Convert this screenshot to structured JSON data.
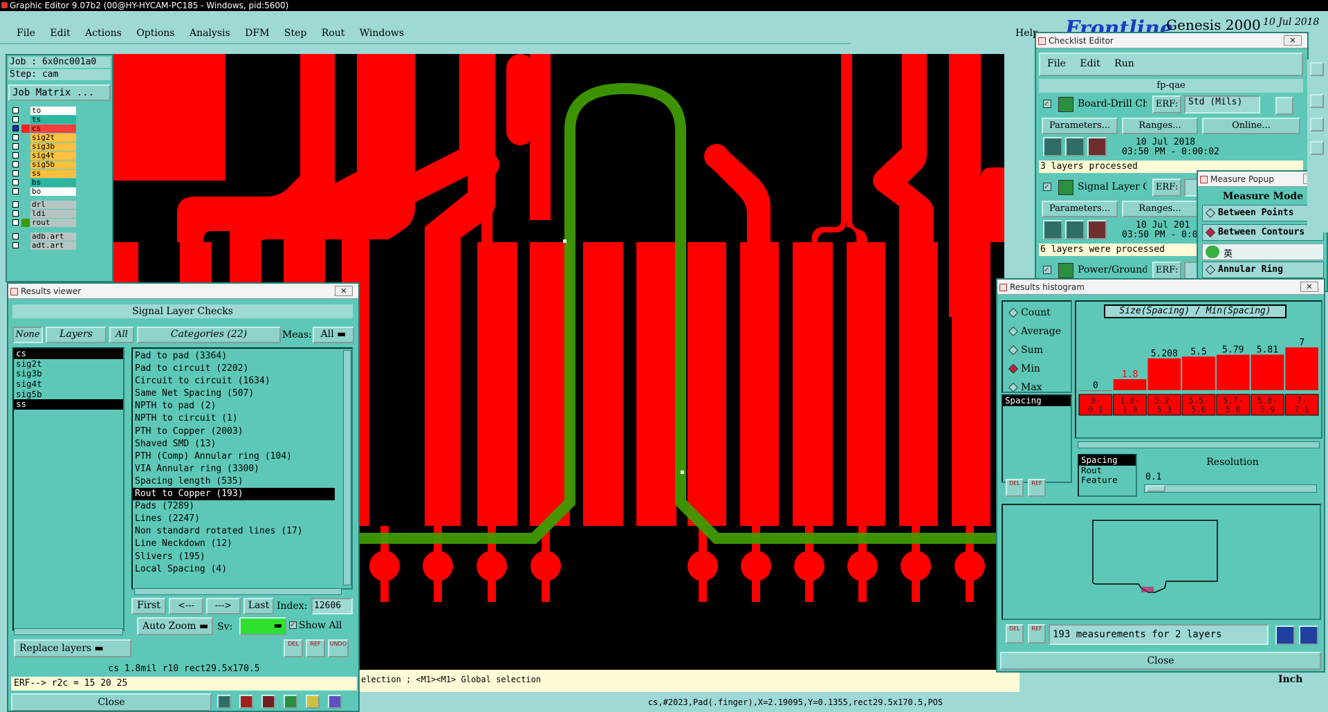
{
  "app": {
    "title": "Graphic Editor 9.07b2 (00@HY-HYCAM-PC185 - Windows, pid:5600)"
  },
  "menu": {
    "items": [
      "File",
      "Edit",
      "Actions",
      "Options",
      "Analysis",
      "DFM",
      "Step",
      "Rout",
      "Windows"
    ],
    "help": "Help"
  },
  "branding": {
    "brand": "Frontline",
    "product": "Genesis 2000",
    "date": "10 Jul 2018",
    "time_fragment": "03:50 PM",
    "subtitle": "Graphic Editor"
  },
  "job": {
    "job_label": "Job : 6x0nc001a0",
    "step_label": "Step: cam",
    "matrix_button": "Job Matrix ..."
  },
  "layers": [
    {
      "name": "to",
      "color": "#ffffff"
    },
    {
      "name": "ts",
      "color": "#2fb59e"
    },
    {
      "name": "cs",
      "color": "#ff3c3c"
    },
    {
      "name": "sig2t",
      "color": "#ffbf40"
    },
    {
      "name": "sig3b",
      "color": "#ffbf40"
    },
    {
      "name": "sig4t",
      "color": "#ffbf40"
    },
    {
      "name": "sig5b",
      "color": "#ffbf40"
    },
    {
      "name": "ss",
      "color": "#ffbf40"
    },
    {
      "name": "bs",
      "color": "#2fb59e"
    },
    {
      "name": "bo",
      "color": "#ffffff"
    },
    {
      "name": "drl",
      "color": "#b7c4c4"
    },
    {
      "name": "ldi",
      "color": "#b7c4c4"
    },
    {
      "name": "rout",
      "color": "#b7c4c4"
    },
    {
      "name": "adb.art",
      "color": "#b7c4c4"
    },
    {
      "name": "adt.art",
      "color": "#b7c4c4"
    }
  ],
  "results_viewer": {
    "title": "Results viewer",
    "header": "Signal Layer Checks",
    "none_btn": "None",
    "layers_btn": "Layers",
    "all_btn": "All",
    "categories_btn": "Categories (22)",
    "meas_label": "Meas:",
    "meas_value": "All",
    "layer_list": [
      "cs",
      "sig2t",
      "sig3b",
      "sig4t",
      "sig5b",
      "ss"
    ],
    "categories": [
      "Pad to pad (3364)",
      "Pad to circuit (2202)",
      "Circuit to circuit (1634)",
      "Same Net Spacing (507)",
      "NPTH to pad (2)",
      "NPTH to circuit (1)",
      "PTH to Copper (2003)",
      "Shaved SMD (13)",
      "PTH (Comp) Annular ring (104)",
      "VIA Annular ring (3300)",
      "Spacing length (535)",
      "Rout to Copper (193)",
      "Pads (7289)",
      "Lines (2247)",
      "Non standard rotated lines (17)",
      "Line Neckdown (12)",
      "Slivers (195)",
      "Local Spacing (4)"
    ],
    "first": "First",
    "prev": "<---",
    "next": "--->",
    "last": "Last",
    "index_label": "Index:",
    "index_value": "12606",
    "auto_zoom": "Auto Zoom",
    "sv_label": "Sv:",
    "show_all": "Show All",
    "replace_layers": "Replace layers",
    "del": "DEL",
    "ref": "REF",
    "undo": "UNDO",
    "status_line": "cs 1.8mil  r10  rect29.5x170.5",
    "erf_line": "ERF--> r2c = 15 20 25",
    "close": "Close"
  },
  "checklist": {
    "title": "Checklist Editor",
    "menu": [
      "File",
      "Edit",
      "Run"
    ],
    "name": "fp-qae",
    "actions": [
      {
        "name": "Board-Drill Che",
        "erf": "ERF:",
        "erf_value": "Std (Mils)",
        "date": "10 Jul 2018",
        "time": "03:50 PM - 0:00:02",
        "status": "3 layers processed"
      },
      {
        "name": "Signal Layer Ch",
        "erf": "ERF:",
        "erf_value": "",
        "date": "10 Jul 201",
        "time": "03:50 PM - 0:0",
        "status": "6 layers were processed"
      },
      {
        "name": "Power/Ground C",
        "erf": "ERF:",
        "erf_value": "",
        "date": "",
        "time": "",
        "status": ""
      }
    ],
    "params": "Parameters...",
    "ranges": "Ranges...",
    "online": "Online..."
  },
  "measure": {
    "title": "Measure Popup",
    "header": "Measure Mode",
    "options": [
      "Between Points",
      "Between Contours",
      "Annular Ring"
    ],
    "ime": "英"
  },
  "histogram": {
    "title": "Results histogram",
    "modes": [
      "Count",
      "Average",
      "Sum",
      "Min",
      "Max"
    ],
    "selected_mode": "Min",
    "list_item": "Spacing",
    "chart_title": "Size(Spacing) / Min(Spacing)",
    "resolution_label": "Resolution",
    "resolution_value": "0.1",
    "res_list": [
      "Spacing",
      "Rout",
      "Feature"
    ],
    "summary": "193 measurements for 2 layers",
    "close": "Close",
    "del": "DEL",
    "ref": "REF"
  },
  "chart_data": {
    "type": "bar",
    "categories": [
      "0-0.1",
      "1.8-1.9",
      "5.2-5.3",
      "5.5-5.6",
      "5.7-5.8",
      "5.8-5.9",
      "7-7.1"
    ],
    "values": [
      0,
      1.8,
      5.208,
      5.5,
      5.79,
      5.81,
      7
    ],
    "labels": [
      "0",
      "1.8",
      "5.208",
      "5.5",
      "5.79",
      "5.81",
      "7"
    ],
    "title": "Size(Spacing) / Min(Spacing)",
    "bar_color": "#ff0000",
    "highlight_label_color": "#ff0000"
  },
  "statusbar": {
    "hint": "election ; <M1><M1> Global selection",
    "info": "cs,#2023,Pad(.finger),X=2.19095,Y=0.1355,rect29.5x170.5,POS",
    "units": "Inch"
  },
  "colors": {
    "background": "#000000",
    "copper": "#ff0000",
    "rout": "#3f9a00",
    "panel": "#5dc8b8"
  }
}
